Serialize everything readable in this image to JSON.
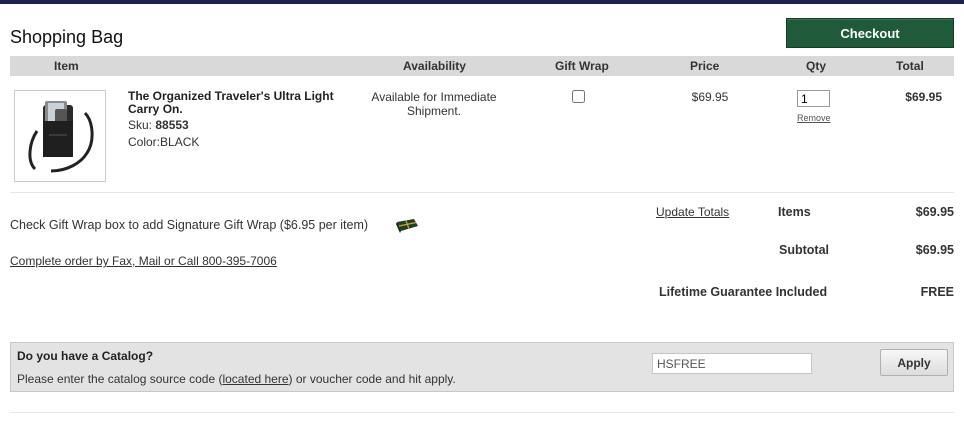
{
  "header": {
    "title": "Shopping Bag",
    "checkout_label": "Checkout"
  },
  "columns": [
    "Item",
    "Availability",
    "Gift Wrap",
    "Price",
    "Qty",
    "Total"
  ],
  "item": {
    "name": "The Organized Traveler's Ultra Light Carry On.",
    "sku_label": "Sku:",
    "sku": "88553",
    "color": "Color:BLACK",
    "availability": "Available for Immediate Shipment.",
    "gift_wrap_checked": false,
    "price": "$69.95",
    "qty": "1",
    "remove_label": "Remove",
    "total": "$69.95"
  },
  "gift_note": "Check Gift Wrap box to add Signature Gift Wrap ($6.95 per item)",
  "order_link": "Complete order by Fax, Mail or Call 800-395-7006",
  "summary": {
    "update_label": "Update Totals",
    "items_label": "Items",
    "items_value": "$69.95",
    "subtotal_label": "Subtotal",
    "subtotal_value": "$69.95",
    "guarantee_label": "Lifetime Guarantee Included",
    "guarantee_value": "FREE"
  },
  "catalog": {
    "title": "Do you have a Catalog?",
    "text_before": "Please enter the catalog source code (",
    "link_text": "located here",
    "text_after": ") or voucher code and hit apply.",
    "code_value": "HSFREE",
    "apply_label": "Apply"
  },
  "colors": {
    "checkout_bg": "#1f5a3a",
    "top_bar": "#1b2350",
    "header_bg": "#d9d9d9"
  }
}
